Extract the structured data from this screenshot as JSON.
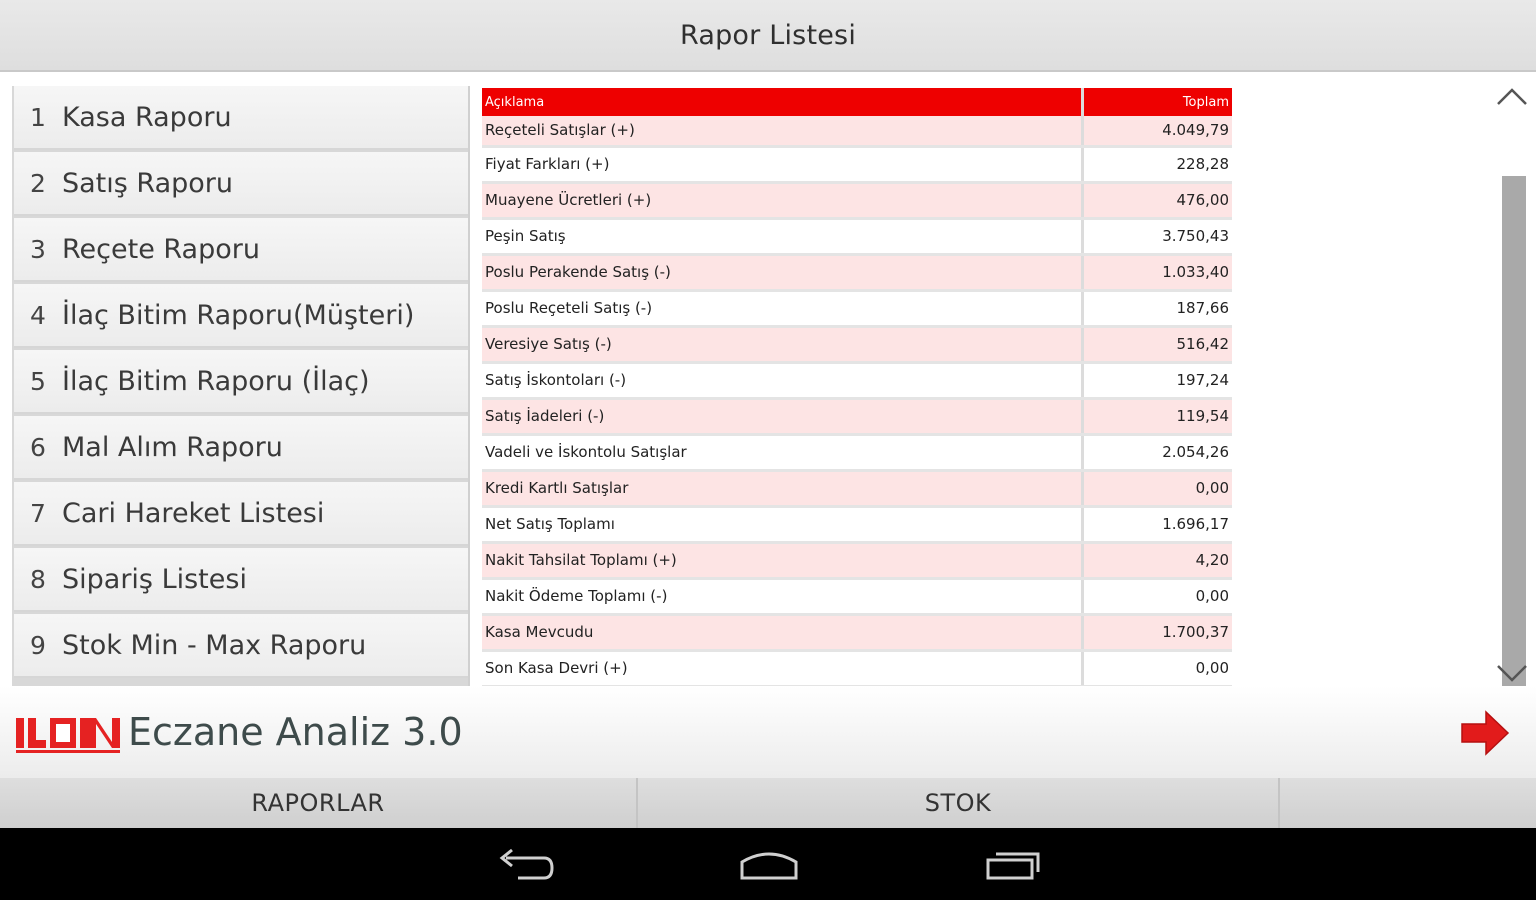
{
  "header": {
    "title": "Rapor Listesi"
  },
  "sidebar": {
    "items": [
      {
        "num": "1",
        "label": "Kasa Raporu"
      },
      {
        "num": "2",
        "label": "Satış Raporu"
      },
      {
        "num": "3",
        "label": "Reçete Raporu"
      },
      {
        "num": "4",
        "label": "İlaç Bitim Raporu(Müşteri)"
      },
      {
        "num": "5",
        "label": "İlaç Bitim Raporu (İlaç)"
      },
      {
        "num": "6",
        "label": "Mal Alım Raporu"
      },
      {
        "num": "7",
        "label": "Cari Hareket Listesi"
      },
      {
        "num": "8",
        "label": "Sipariş Listesi"
      },
      {
        "num": "9",
        "label": "Stok Min - Max Raporu"
      }
    ]
  },
  "table": {
    "headers": [
      "Açıklama",
      "Toplam"
    ],
    "rows": [
      [
        "Reçeteli Satışlar (+)",
        "4.049,79"
      ],
      [
        "Fiyat Farkları (+)",
        "228,28"
      ],
      [
        "Muayene Ücretleri (+)",
        "476,00"
      ],
      [
        "Peşin Satış",
        "3.750,43"
      ],
      [
        "Poslu Perakende Satış (-)",
        "1.033,40"
      ],
      [
        "Poslu Reçeteli Satış (-)",
        "187,66"
      ],
      [
        "Veresiye Satış (-)",
        "516,42"
      ],
      [
        "Satış İskontoları (-)",
        "197,24"
      ],
      [
        "Satış İadeleri (-)",
        "119,54"
      ],
      [
        "Vadeli ve İskontolu Satışlar",
        "2.054,26"
      ],
      [
        "Kredi Kartlı Satışlar",
        "0,00"
      ],
      [
        "Net Satış Toplamı",
        "1.696,17"
      ],
      [
        "Nakit Tahsilat Toplamı (+)",
        "4,20"
      ],
      [
        "Nakit Ödeme Toplamı (-)",
        "0,00"
      ],
      [
        "Kasa Mevcudu",
        "1.700,37"
      ],
      [
        "Son Kasa Devri (+)",
        "0,00"
      ]
    ]
  },
  "brand": {
    "logo_text": "ILON",
    "app_title": "Eczane Analiz 3.0"
  },
  "tabs": [
    {
      "label": "RAPORLAR"
    },
    {
      "label": "STOK"
    },
    {
      "label": ""
    }
  ],
  "icons": {
    "scroll_up": "chevron-up-icon",
    "scroll_down": "chevron-down-icon",
    "next": "red-arrow-right-icon",
    "nav": [
      "back-icon",
      "home-icon",
      "recent-apps-icon"
    ]
  },
  "colors": {
    "header_red": "#ee0000",
    "row_pink": "#fde4e4",
    "arrow_red": "#e21b1b",
    "navbar": "#000000"
  }
}
